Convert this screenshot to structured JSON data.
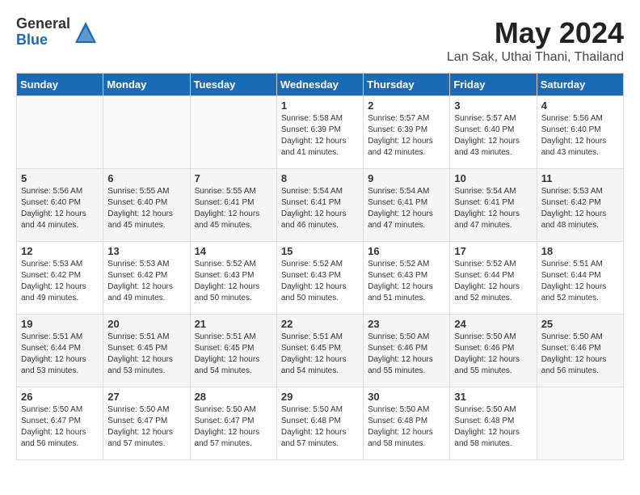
{
  "logo": {
    "general": "General",
    "blue": "Blue"
  },
  "title": {
    "month": "May 2024",
    "location": "Lan Sak, Uthai Thani, Thailand"
  },
  "headers": [
    "Sunday",
    "Monday",
    "Tuesday",
    "Wednesday",
    "Thursday",
    "Friday",
    "Saturday"
  ],
  "weeks": [
    [
      {
        "day": "",
        "info": ""
      },
      {
        "day": "",
        "info": ""
      },
      {
        "day": "",
        "info": ""
      },
      {
        "day": "1",
        "info": "Sunrise: 5:58 AM\nSunset: 6:39 PM\nDaylight: 12 hours\nand 41 minutes."
      },
      {
        "day": "2",
        "info": "Sunrise: 5:57 AM\nSunset: 6:39 PM\nDaylight: 12 hours\nand 42 minutes."
      },
      {
        "day": "3",
        "info": "Sunrise: 5:57 AM\nSunset: 6:40 PM\nDaylight: 12 hours\nand 43 minutes."
      },
      {
        "day": "4",
        "info": "Sunrise: 5:56 AM\nSunset: 6:40 PM\nDaylight: 12 hours\nand 43 minutes."
      }
    ],
    [
      {
        "day": "5",
        "info": "Sunrise: 5:56 AM\nSunset: 6:40 PM\nDaylight: 12 hours\nand 44 minutes."
      },
      {
        "day": "6",
        "info": "Sunrise: 5:55 AM\nSunset: 6:40 PM\nDaylight: 12 hours\nand 45 minutes."
      },
      {
        "day": "7",
        "info": "Sunrise: 5:55 AM\nSunset: 6:41 PM\nDaylight: 12 hours\nand 45 minutes."
      },
      {
        "day": "8",
        "info": "Sunrise: 5:54 AM\nSunset: 6:41 PM\nDaylight: 12 hours\nand 46 minutes."
      },
      {
        "day": "9",
        "info": "Sunrise: 5:54 AM\nSunset: 6:41 PM\nDaylight: 12 hours\nand 47 minutes."
      },
      {
        "day": "10",
        "info": "Sunrise: 5:54 AM\nSunset: 6:41 PM\nDaylight: 12 hours\nand 47 minutes."
      },
      {
        "day": "11",
        "info": "Sunrise: 5:53 AM\nSunset: 6:42 PM\nDaylight: 12 hours\nand 48 minutes."
      }
    ],
    [
      {
        "day": "12",
        "info": "Sunrise: 5:53 AM\nSunset: 6:42 PM\nDaylight: 12 hours\nand 49 minutes."
      },
      {
        "day": "13",
        "info": "Sunrise: 5:53 AM\nSunset: 6:42 PM\nDaylight: 12 hours\nand 49 minutes."
      },
      {
        "day": "14",
        "info": "Sunrise: 5:52 AM\nSunset: 6:43 PM\nDaylight: 12 hours\nand 50 minutes."
      },
      {
        "day": "15",
        "info": "Sunrise: 5:52 AM\nSunset: 6:43 PM\nDaylight: 12 hours\nand 50 minutes."
      },
      {
        "day": "16",
        "info": "Sunrise: 5:52 AM\nSunset: 6:43 PM\nDaylight: 12 hours\nand 51 minutes."
      },
      {
        "day": "17",
        "info": "Sunrise: 5:52 AM\nSunset: 6:44 PM\nDaylight: 12 hours\nand 52 minutes."
      },
      {
        "day": "18",
        "info": "Sunrise: 5:51 AM\nSunset: 6:44 PM\nDaylight: 12 hours\nand 52 minutes."
      }
    ],
    [
      {
        "day": "19",
        "info": "Sunrise: 5:51 AM\nSunset: 6:44 PM\nDaylight: 12 hours\nand 53 minutes."
      },
      {
        "day": "20",
        "info": "Sunrise: 5:51 AM\nSunset: 6:45 PM\nDaylight: 12 hours\nand 53 minutes."
      },
      {
        "day": "21",
        "info": "Sunrise: 5:51 AM\nSunset: 6:45 PM\nDaylight: 12 hours\nand 54 minutes."
      },
      {
        "day": "22",
        "info": "Sunrise: 5:51 AM\nSunset: 6:45 PM\nDaylight: 12 hours\nand 54 minutes."
      },
      {
        "day": "23",
        "info": "Sunrise: 5:50 AM\nSunset: 6:46 PM\nDaylight: 12 hours\nand 55 minutes."
      },
      {
        "day": "24",
        "info": "Sunrise: 5:50 AM\nSunset: 6:46 PM\nDaylight: 12 hours\nand 55 minutes."
      },
      {
        "day": "25",
        "info": "Sunrise: 5:50 AM\nSunset: 6:46 PM\nDaylight: 12 hours\nand 56 minutes."
      }
    ],
    [
      {
        "day": "26",
        "info": "Sunrise: 5:50 AM\nSunset: 6:47 PM\nDaylight: 12 hours\nand 56 minutes."
      },
      {
        "day": "27",
        "info": "Sunrise: 5:50 AM\nSunset: 6:47 PM\nDaylight: 12 hours\nand 57 minutes."
      },
      {
        "day": "28",
        "info": "Sunrise: 5:50 AM\nSunset: 6:47 PM\nDaylight: 12 hours\nand 57 minutes."
      },
      {
        "day": "29",
        "info": "Sunrise: 5:50 AM\nSunset: 6:48 PM\nDaylight: 12 hours\nand 57 minutes."
      },
      {
        "day": "30",
        "info": "Sunrise: 5:50 AM\nSunset: 6:48 PM\nDaylight: 12 hours\nand 58 minutes."
      },
      {
        "day": "31",
        "info": "Sunrise: 5:50 AM\nSunset: 6:48 PM\nDaylight: 12 hours\nand 58 minutes."
      },
      {
        "day": "",
        "info": ""
      }
    ]
  ]
}
